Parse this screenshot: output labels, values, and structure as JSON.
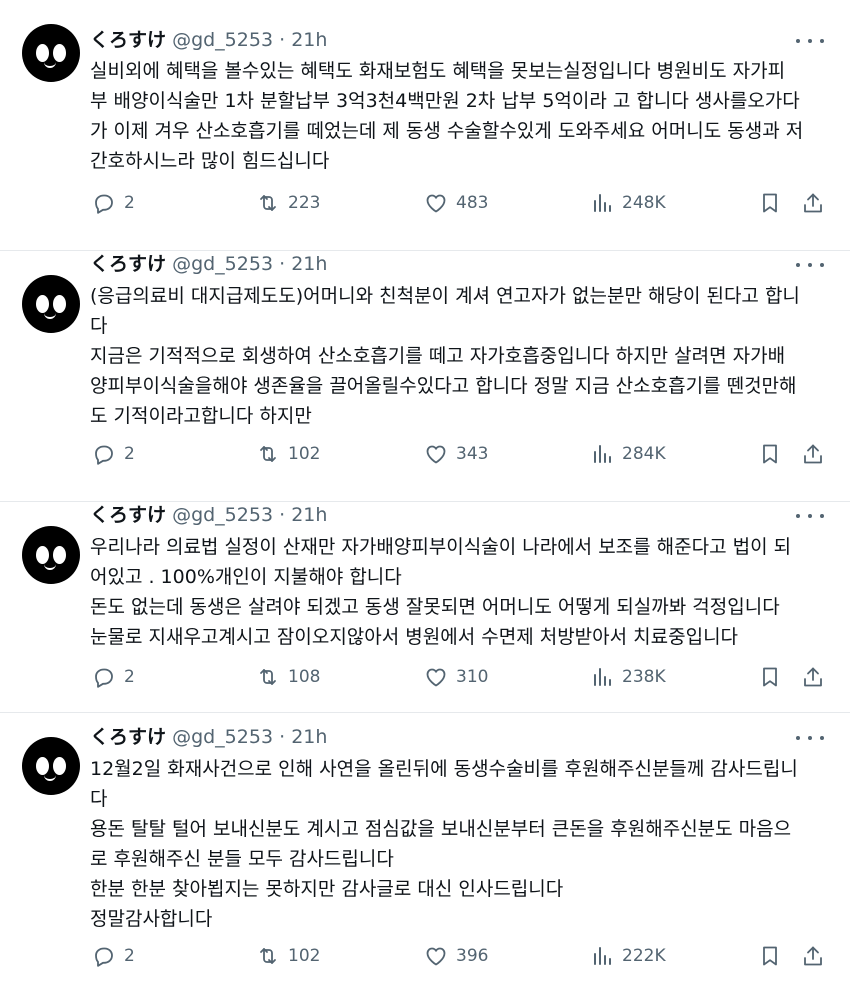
{
  "tweets": [
    {
      "author": {
        "name": "くろすけ",
        "handle": "@gd_5253",
        "separator": "·",
        "time": "21h"
      },
      "text_lines": [
        "실비외에 혜택을 볼수있는 혜택도 화재보험도 혜택을 못보는실정입니다 병원비도 자가피",
        "부 배양이식술만 1차 분할납부 3억3천4백만원 2차 납부 5억이라 고 합니다 생사를오가다",
        "가 이제 겨우 산소호흡기를 떼었는데 제 동생 수술할수있게 도와주세요 어머니도 동생과 저",
        "간호하시느라 많이 힘드십니다"
      ],
      "stats": {
        "replies": "2",
        "retweets": "223",
        "likes": "483",
        "views": "248K"
      }
    },
    {
      "author": {
        "name": "くろすけ",
        "handle": "@gd_5253",
        "separator": "·",
        "time": "21h"
      },
      "text_lines": [
        "(응급의료비 대지급제도도)어머니와 친척분이 계셔 연고자가 없는분만 해당이 된다고 합니",
        "다",
        "지금은 기적적으로 회생하여 산소호흡기를 떼고 자가호흡중입니다 하지만 살려면 자가배",
        "양피부이식술을해야 생존율을 끌어올릴수있다고 합니다 정말 지금 산소호흡기를 뗀것만해",
        "도 기적이라고합니다 하지만"
      ],
      "stats": {
        "replies": "2",
        "retweets": "102",
        "likes": "343",
        "views": "284K"
      }
    },
    {
      "author": {
        "name": "くろすけ",
        "handle": "@gd_5253",
        "separator": "·",
        "time": "21h"
      },
      "text_lines": [
        "우리나라 의료법 실정이 산재만 자가배양피부이식술이 나라에서 보조를 해준다고 법이 되",
        "어있고 . 100%개인이 지불해야 합니다",
        "돈도 없는데 동생은 살려야 되겠고 동생 잘못되면 어머니도 어떻게 되실까봐 걱정입니다",
        "눈물로 지새우고계시고 잠이오지않아서 병원에서 수면제 처방받아서 치료중입니다"
      ],
      "stats": {
        "replies": "2",
        "retweets": "108",
        "likes": "310",
        "views": "238K"
      }
    },
    {
      "author": {
        "name": "くろすけ",
        "handle": "@gd_5253",
        "separator": "·",
        "time": "21h"
      },
      "text_lines": [
        "12월2일 화재사건으로 인해 사연을 올린뒤에 동생수술비를 후원해주신분들께 감사드립니",
        "다",
        "용돈 탈탈 털어 보내신분도 계시고 점심값을 보내신분부터 큰돈을 후원해주신분도 마음으",
        "로 후원해주신 분들 모두 감사드립니다",
        "한분 한분 찾아뵙지는 못하지만 감사글로 대신 인사드립니다",
        "정말감사합니다"
      ],
      "stats": {
        "replies": "2",
        "retweets": "102",
        "likes": "396",
        "views": "222K"
      }
    }
  ],
  "colors": {
    "text": "#0f1419",
    "muted": "#536471",
    "divider": "#e6e9ec",
    "background": "#ffffff"
  },
  "icons": [
    "more-icon",
    "reply-icon",
    "retweet-icon",
    "like-icon",
    "views-icon",
    "bookmark-icon",
    "share-icon"
  ]
}
